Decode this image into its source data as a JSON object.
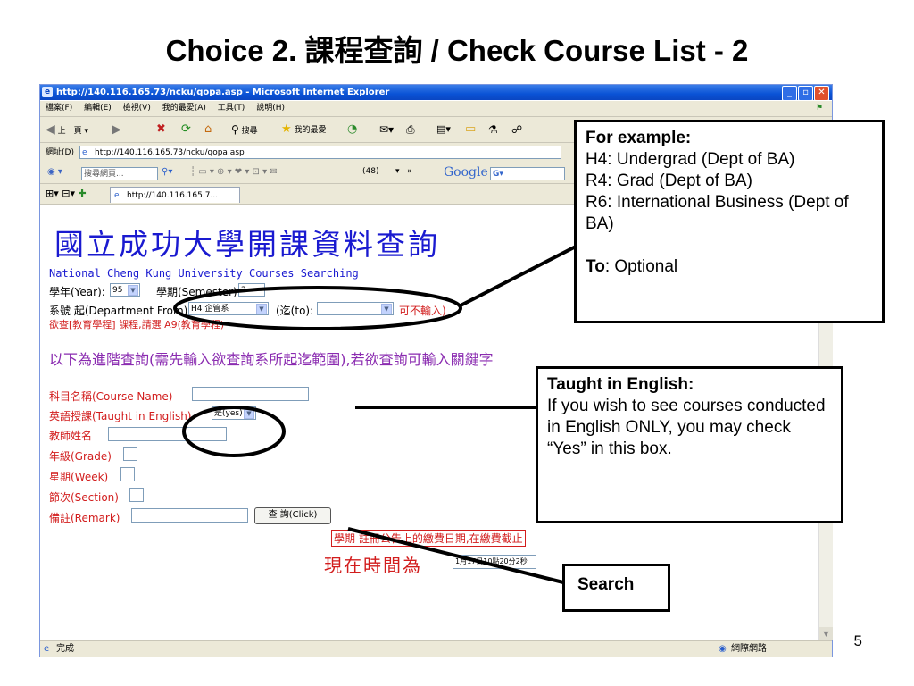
{
  "slide": {
    "title": "Choice 2. 課程查詢 / Check Course List - 2",
    "page_number": "5"
  },
  "browser": {
    "window_title": "http://140.116.165.73/ncku/qopa.asp - Microsoft Internet Explorer",
    "menu": [
      "檔案(F)",
      "編輯(E)",
      "檢視(V)",
      "我的最愛(A)",
      "工具(T)",
      "說明(H)"
    ],
    "back_label": "上一頁",
    "search_label": "搜尋",
    "favorites_label": "我的最愛",
    "address_label": "網址(D)",
    "address_value": "http://140.116.165.73/ncku/qopa.asp",
    "search_placeholder": "搜尋網頁...",
    "mail_count": "(48)",
    "google_label": "Google",
    "google_g": "G",
    "tab_title": "http://140.116.165.7...",
    "status_text": "完成",
    "zone_text": "網際網路"
  },
  "page": {
    "heading_cn": "國立成功大學開課資料查詢",
    "heading_en": "National Cheng Kung University Courses Searching",
    "year_label": "學年(Year):",
    "year_value": "95",
    "semester_label": "學期(Semester):",
    "semester_value": "2",
    "dept_label": "系號 起(Department From):",
    "dept_from_value": "H4 企管系",
    "dept_to_label": "(迄(to):",
    "dept_to_value": "",
    "no_input_note": "可不輸入)",
    "edu_note": "欲查[教育學程] 課程,請選 A9(教育學程)",
    "advanced_note": "以下為進階查詢(需先輸入欲查詢系所起迄範圍),若欲查詢可輸入關鍵字",
    "course_name_label": "科目名稱(Course Name)",
    "taught_english_label": "英語授課(Taught in English)",
    "taught_english_value": "是(yes)",
    "teacher_label": "教師姓名",
    "grade_label": "年級(Grade)",
    "week_label": "星期(Week)",
    "section_label": "節次(Section)",
    "remark_label": "備註(Remark)",
    "query_button": "查 詢(Click)",
    "fee_notice": "學期 註冊公告上的繳費日期,在繳費截止",
    "now_time_label": "現在時間為",
    "now_time_value": "1月17日10點20分2秒"
  },
  "callouts": {
    "example": {
      "heading": "For example:",
      "lines": [
        "H4: Undergrad (Dept of BA)",
        "R4: Grad (Dept of BA)",
        "R6: International Business (Dept of BA)"
      ],
      "to_label": "To",
      "to_text": ": Optional"
    },
    "english": {
      "heading": "Taught in English:",
      "text": "If you wish to see courses conducted in English ONLY, you may check “Yes” in this box."
    },
    "search": {
      "text": "Search"
    }
  },
  "colors": {
    "title_bar": "#0a53d6",
    "heading_blue": "#1a1ad0",
    "form_red": "#d21d1d"
  }
}
